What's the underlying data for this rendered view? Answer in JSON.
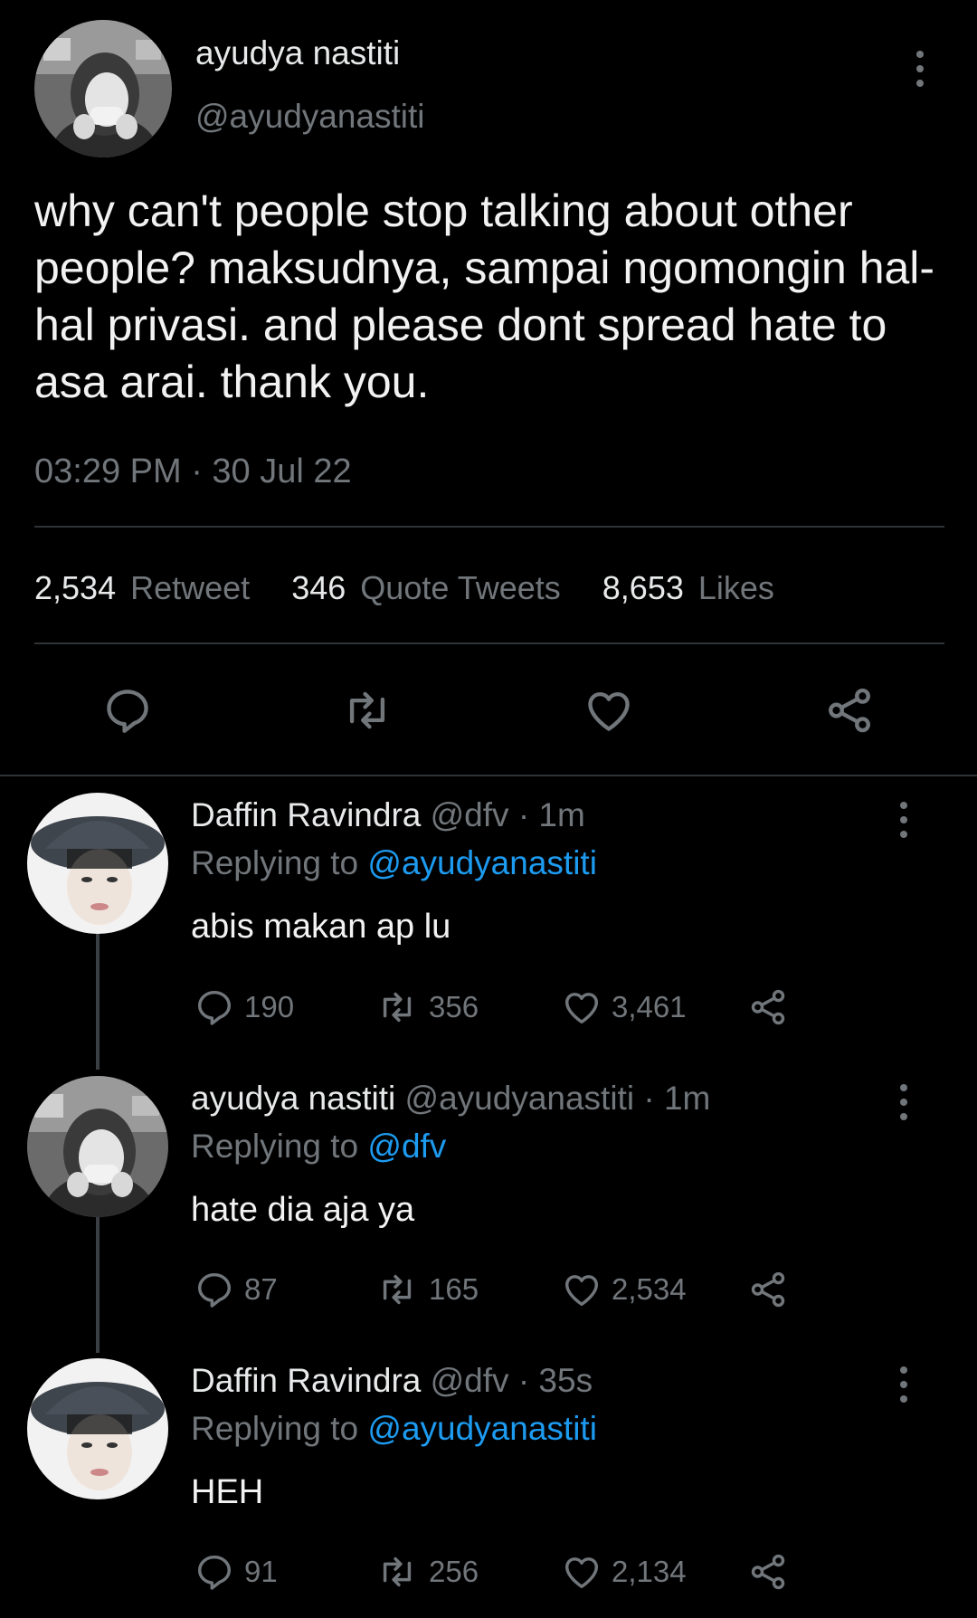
{
  "main_tweet": {
    "author_name": "ayudya nastiti",
    "author_handle": "@ayudyanastiti",
    "text": "why can't people stop talking about other people? maksudnya, sampai ngomongin hal-hal privasi. and please dont spread hate to asa arai. thank you.",
    "timestamp": "03:29 PM · 30 Jul 22",
    "stats": {
      "retweets_count": "2,534",
      "retweets_label": "Retweet",
      "quotes_count": "346",
      "quotes_label": "Quote Tweets",
      "likes_count": "8,653",
      "likes_label": "Likes"
    }
  },
  "replies": [
    {
      "author_name": "Daffin Ravindra",
      "author_handle": "@dfv",
      "time": "· 1m",
      "replying_label": "Replying to",
      "replying_to": "@ayudyanastiti",
      "text": "abis makan ap lu",
      "reply_count": "190",
      "retweet_count": "356",
      "like_count": "3,461"
    },
    {
      "author_name": "ayudya nastiti",
      "author_handle": "@ayudyanastiti",
      "time": "· 1m",
      "replying_label": "Replying to",
      "replying_to": "@dfv",
      "text": "hate dia aja ya",
      "reply_count": "87",
      "retweet_count": "165",
      "like_count": "2,534"
    },
    {
      "author_name": "Daffin Ravindra",
      "author_handle": "@dfv",
      "time": "· 35s",
      "replying_label": "Replying to",
      "replying_to": "@ayudyanastiti",
      "text": "HEH",
      "reply_count": "91",
      "retweet_count": "256",
      "like_count": "2,134"
    }
  ],
  "icons": [
    "more-icon",
    "reply-icon",
    "retweet-icon",
    "like-icon",
    "share-icon"
  ],
  "colors": {
    "background": "#000000",
    "text": "#e7e9ea",
    "muted": "#71767b",
    "link": "#1d9bf0",
    "divider": "#2f3336"
  }
}
